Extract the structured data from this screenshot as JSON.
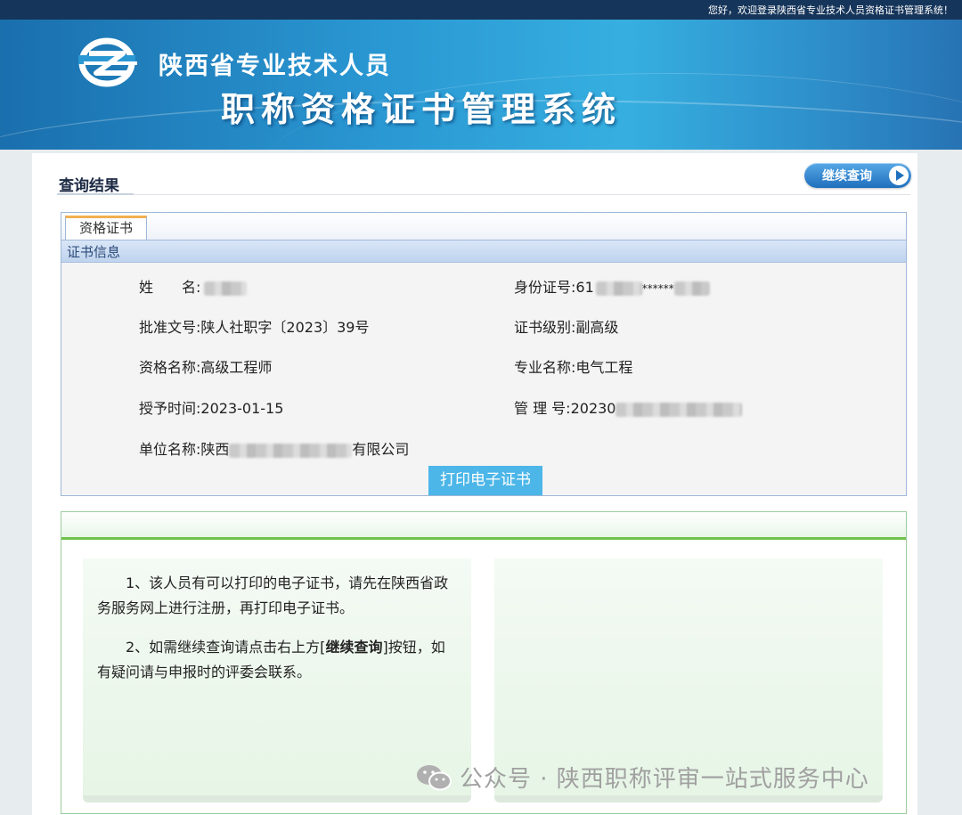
{
  "topbar": {
    "welcome": "您好，欢迎登录陕西省专业技术人员资格证书管理系统！"
  },
  "header": {
    "title_line1": "陕西省专业技术人员",
    "title_line2": "职称资格证书管理系统"
  },
  "result": {
    "title": "查询结果",
    "continue_button": "继续查询"
  },
  "certificate": {
    "tab_label": "资格证书",
    "section_title": "证书信息",
    "fields": {
      "name_label": "姓　　名:",
      "id_label": "身份证号:",
      "id_value_prefix": "61",
      "id_value_mid": "******",
      "approval_label": "批准文号:",
      "approval_value": "陕人社职字〔2023〕39号",
      "level_label": "证书级别:",
      "level_value": "副高级",
      "qual_label": "资格名称:",
      "qual_value": "高级工程师",
      "major_label": "专业名称:",
      "major_value": "电气工程",
      "grant_label": "授予时间:",
      "grant_value": "2023-01-15",
      "mgmt_label": "管 理 号:",
      "mgmt_value_prefix": "20230",
      "unit_label": "单位名称:",
      "unit_value_prefix": "陕西",
      "unit_value_suffix": "有限公司"
    },
    "print_button": "打印电子证书"
  },
  "notice": {
    "item1": "1、该人员有可以打印的电子证书，请先在陕西省政务服务网上进行注册，再打印电子证书。",
    "item2_before": "2、如需继续查询请点击右上方[",
    "item2_bold": "继续查询",
    "item2_after": "]按钮，如有疑问请与申报时的评委会联系。"
  },
  "watermark": {
    "text": "公众号 · 陕西职称评审一站式服务中心"
  }
}
